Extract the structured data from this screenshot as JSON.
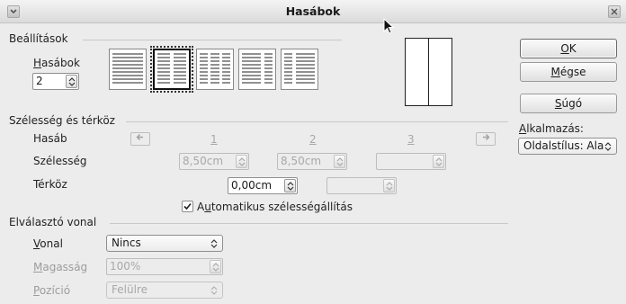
{
  "window": {
    "title": "Hasábok"
  },
  "settings": {
    "section_label": "Beállítások",
    "columns_label_pre": "",
    "columns_label_ul": "H",
    "columns_label_post": "asábok",
    "columns_value": "2"
  },
  "buttons": {
    "ok_ul": "O",
    "ok_post": "K",
    "cancel_ul": "M",
    "cancel_post": "égse",
    "help_ul": "S",
    "help_post": "úgó"
  },
  "apply": {
    "label_ul": "A",
    "label_post": "lkalmazás:",
    "value": "Oldalstílus: Ala"
  },
  "width_spacing": {
    "section_label": "Szélesség és térköz",
    "column_label": "Hasáb",
    "width_label": "Szélesség",
    "spacing_label": "Térköz",
    "col_numbers": [
      "1",
      "2",
      "3"
    ],
    "width_values": [
      "8,50cm",
      "8,50cm",
      ""
    ],
    "spacing_values": [
      "0,00cm",
      ""
    ],
    "auto_width_pre": "A",
    "auto_width_ul": "u",
    "auto_width_post": "tomatikus szélességállítás",
    "auto_width_checked": true
  },
  "separator": {
    "section_label": "Elválasztó vonal",
    "line_label_ul": "V",
    "line_label_post": "onal",
    "line_value": "Nincs",
    "height_label_ul": "M",
    "height_label_post": "agasság",
    "height_value": "100%",
    "position_label_ul": "P",
    "position_label_post": "ozíció",
    "position_value": "Felülre"
  }
}
